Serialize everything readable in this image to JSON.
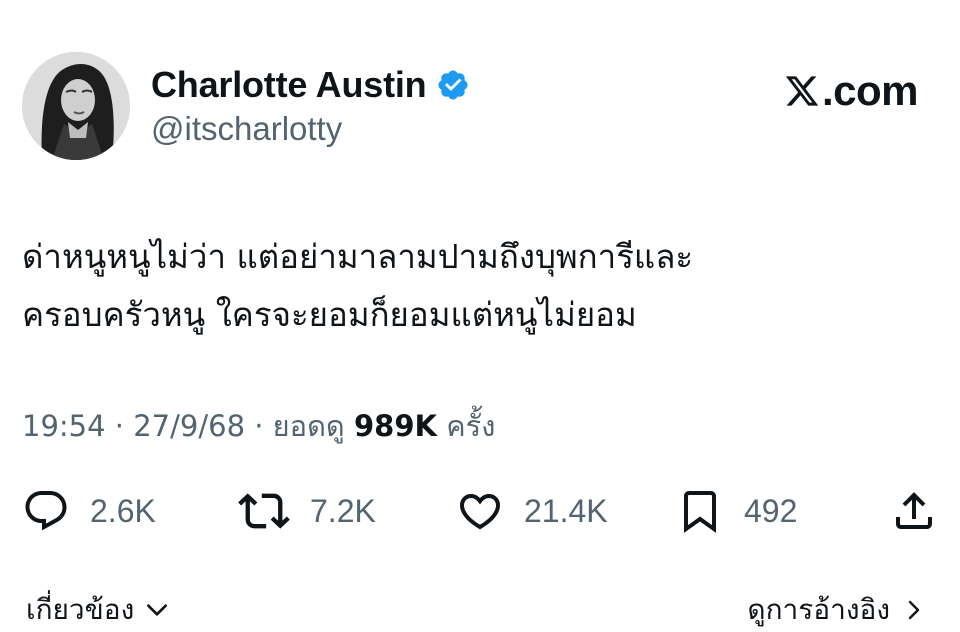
{
  "author": {
    "display_name": "Charlotte Austin",
    "handle": "@itscharlotty",
    "avatar_icon": "avatar-portrait",
    "verified": true,
    "verified_color": "#1d9bf0"
  },
  "brand": {
    "domain_text": "com",
    "logo_icon": "x-logo-icon"
  },
  "tweet": {
    "text_lines": [
      "ด่าหนูหนูไม่ว่า แต่อย่ามาลามปามถึงบุพการีและ",
      "ครอบครัวหนู ใครจะยอมก็ยอมแต่หนูไม่ยอม"
    ],
    "meta_prefix": "19:54 · 27/9/68 · ยอดดู ",
    "views": "989K",
    "meta_suffix": " ครั้ง"
  },
  "actions": {
    "replies": "2.6K",
    "reposts": "7.2K",
    "likes": "21.4K",
    "bookmarks": "492",
    "icons": [
      "reply-icon",
      "repost-icon",
      "heart-icon",
      "bookmark-icon",
      "share-icon"
    ]
  },
  "footer": {
    "related_label": "เกี่ยวข้อง",
    "quotes_label": "ดูการอ้างอิง"
  },
  "colors": {
    "text_primary": "#0f1419",
    "text_secondary": "#536471"
  }
}
